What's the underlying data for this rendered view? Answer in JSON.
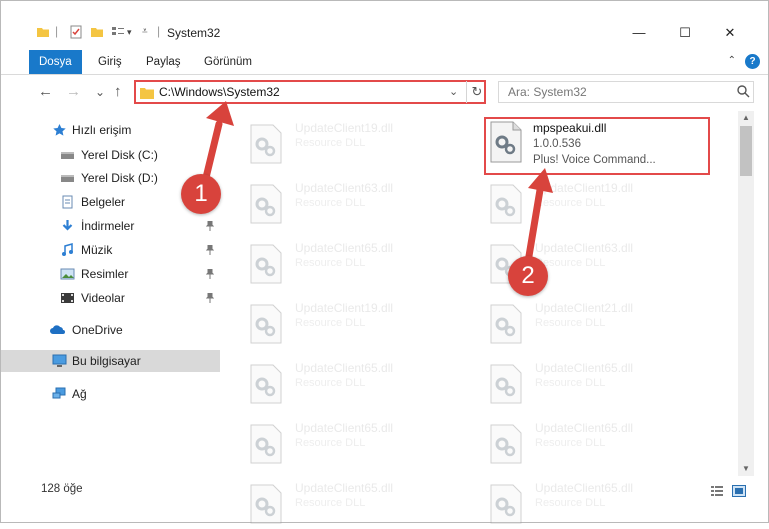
{
  "window": {
    "title": "System32",
    "controls": {
      "minimize": "—",
      "maximize": "☐",
      "close": "✕"
    }
  },
  "ribbon": {
    "tabs": [
      {
        "label": "Dosya",
        "active": true
      },
      {
        "label": "Giriş",
        "active": false
      },
      {
        "label": "Paylaş",
        "active": false
      },
      {
        "label": "Görünüm",
        "active": false
      }
    ],
    "help": "?"
  },
  "nav": {
    "back": "←",
    "forward": "→",
    "recent": "⌄",
    "up": "↑",
    "address": "C:\\Windows\\System32",
    "refresh": "↻",
    "search_placeholder": "Ara: System32"
  },
  "sidebar": {
    "items": [
      {
        "label": "Hızlı erişim",
        "icon": "star-icon"
      },
      {
        "label": "Yerel Disk (C:)",
        "icon": "drive-icon"
      },
      {
        "label": "Yerel Disk (D:)",
        "icon": "drive-icon"
      },
      {
        "label": "Belgeler",
        "icon": "documents-icon"
      },
      {
        "label": "İndirmeler",
        "icon": "download-icon"
      },
      {
        "label": "Müzik",
        "icon": "music-icon"
      },
      {
        "label": "Resimler",
        "icon": "pictures-icon"
      },
      {
        "label": "Videolar",
        "icon": "video-icon"
      },
      {
        "label": "OneDrive",
        "icon": "cloud-icon"
      },
      {
        "label": "Bu bilgisayar",
        "icon": "computer-icon",
        "selected": true
      },
      {
        "label": "Ağ",
        "icon": "network-icon"
      }
    ]
  },
  "files": {
    "left": [
      {
        "name": "UpdateClient19.dll",
        "desc": "Resource DLL"
      },
      {
        "name": "UpdateClient63.dll",
        "desc": "Resource DLL"
      },
      {
        "name": "UpdateClient65.dll",
        "desc": "Resource DLL"
      },
      {
        "name": "UpdateClient19.dll",
        "desc": "Resource DLL"
      },
      {
        "name": "UpdateClient65.dll",
        "desc": "Resource DLL"
      },
      {
        "name": "UpdateClient65.dll",
        "desc": "Resource DLL"
      },
      {
        "name": "UpdateClient65.dll",
        "desc": "Resource DLL"
      }
    ],
    "right": [
      {
        "name": "UpdateClient19.dll",
        "desc": "Resource DLL"
      },
      {
        "name": "UpdateClient63.dll",
        "desc": "Resource DLL"
      },
      {
        "name": "UpdateClient21.dll",
        "desc": "Resource DLL"
      },
      {
        "name": "UpdateClient65.dll",
        "desc": "Resource DLL"
      },
      {
        "name": "UpdateClient65.dll",
        "desc": "Resource DLL"
      },
      {
        "name": "UpdateClient65.dll",
        "desc": "Resource DLL"
      }
    ],
    "highlighted": {
      "name": "mpspeakui.dll",
      "version": "1.0.0.536",
      "desc": "Plus! Voice Command..."
    }
  },
  "status": {
    "count": "128 öğe"
  },
  "annotations": {
    "step1": "1",
    "step2": "2"
  },
  "colors": {
    "accent": "#1979ca",
    "annotation": "#d8433c"
  }
}
